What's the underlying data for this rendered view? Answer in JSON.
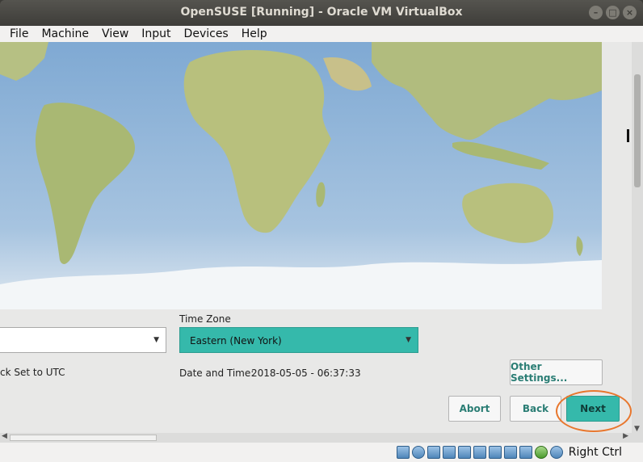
{
  "window": {
    "title": "OpenSUSE [Running] - Oracle VM VirtualBox",
    "controls": {
      "minimize": "–",
      "maximize": "□",
      "close": "×"
    }
  },
  "menubar": {
    "items": [
      "File",
      "Machine",
      "Input",
      "Devices",
      "Help"
    ],
    "view": "View"
  },
  "timezone_panel": {
    "timezone_label": "Time Zone",
    "timezone_value": "Eastern (New York)",
    "clock_label": "ck Set to UTC",
    "date_time_label": "Date and Time:",
    "date_time_value": "2018-05-05 - 06:37:33"
  },
  "buttons": {
    "other_settings": "Other Settings...",
    "abort": "Abort",
    "back": "Back",
    "next": "Next"
  },
  "statusbar": {
    "host_key": "Right Ctrl",
    "icons": [
      "hard-disk-icon",
      "optical-drive-icon",
      "audio-icon",
      "network-icon",
      "usb-icon",
      "shared-folders-icon",
      "display-icon",
      "video-capture-icon",
      "cpu-icon",
      "guest-additions-icon",
      "mouse-integration-icon"
    ]
  },
  "colors": {
    "accent": "#35b9ab",
    "highlight_ring": "#e8772e",
    "ocean": "#8fb5d8",
    "land": "#b9c488"
  }
}
